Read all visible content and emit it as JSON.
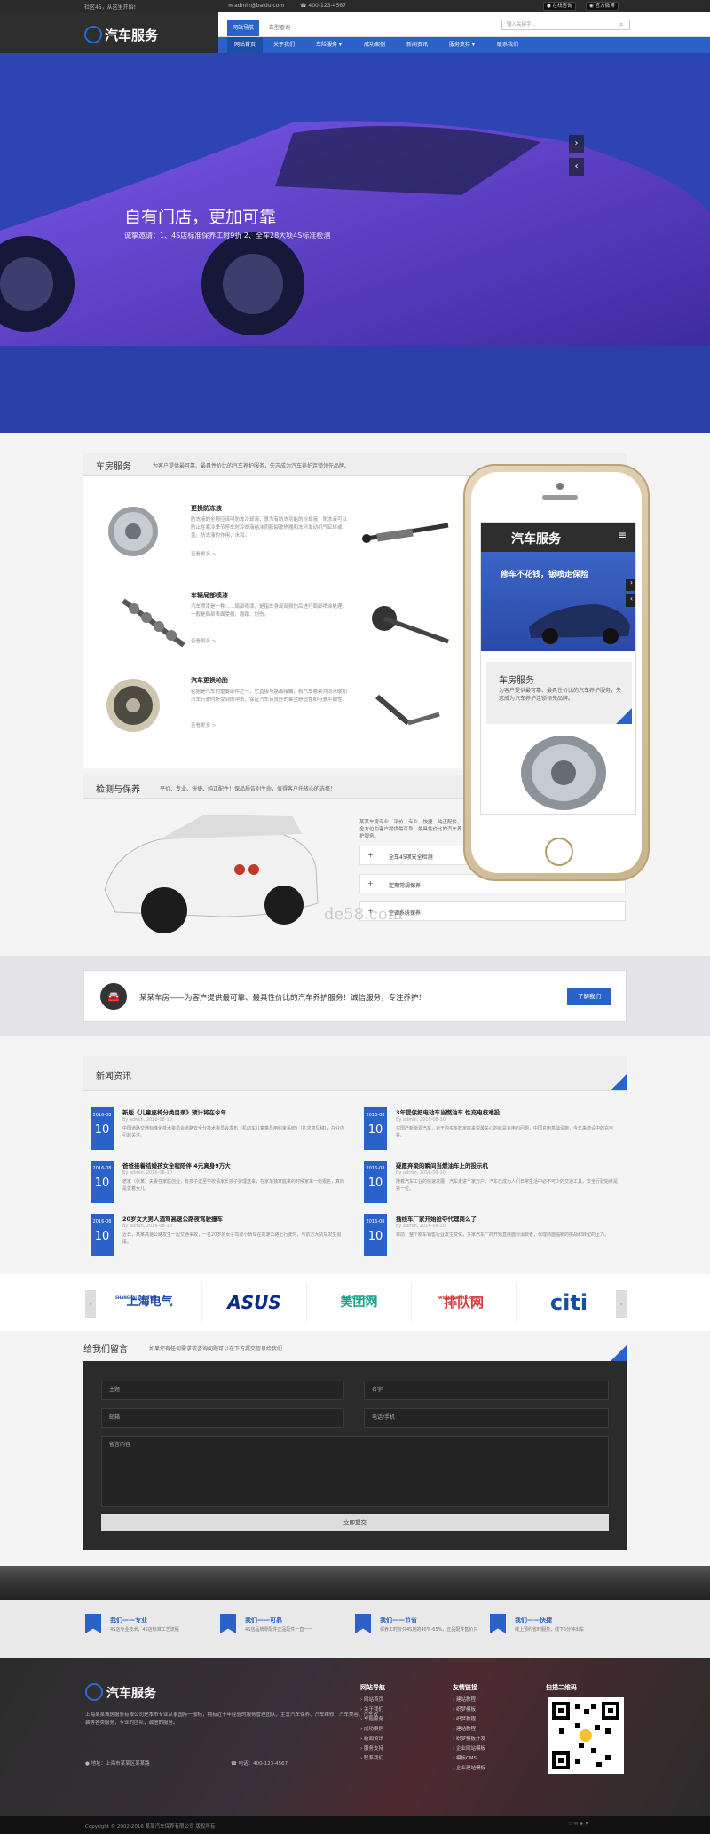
{
  "topbar": {
    "welcome": "社区45，从这里开始!",
    "email": "admin@baidu.com",
    "phone": "400-123-4567",
    "btn_online": "在线咨询",
    "btn_weibo": "官方微博"
  },
  "header": {
    "logo_text": "汽车服务",
    "tabs": [
      "网站导航",
      "车型查询"
    ],
    "search_placeholder": "输入关键字..."
  },
  "nav": [
    "网站首页",
    "关于我们",
    "车险服务",
    "成功案例",
    "新闻资讯",
    "服务支持",
    "联系我们"
  ],
  "hero": {
    "title": "自有门店，更加可靠",
    "subtitle": "诚挚邀请：1、4S店标准保养工时9折 2、全车28大项4S标准检测",
    "prev": "›",
    "next": "‹"
  },
  "services": {
    "title": "车房服务",
    "desc": "为客户提供最可靠、最具性价比的汽车养护服务，失志成为汽车养护连锁领先品牌。",
    "items": [
      {
        "title": "更换防冻液",
        "desc": "防冻液的全称应该叫防冻冷却液，意为有防冻功能的冷却液，防冻液可以防止在寒冷季节停车时冷却液结冰而胀裂散热器和冻坏发动机气缸体或盖。防冻液的作用，水和。",
        "more": "查看更多 >"
      },
      {
        "title": "车辆局部喷漆",
        "desc": "汽车喷漆是一种……局部喷漆，是指车身局部损伤后进行局部喷涂处理，一般是局部表面受损、剐蹭、划伤。",
        "more": "查看更多 >"
      },
      {
        "title": "汽车更换轮胎",
        "desc": "轮胎是汽车的重要部件之一，它直接与路面接触，和汽车悬架共同来缓和汽车行驶时所受到的冲击，保证汽车有良好的乘坐舒适性和行驶平顺性。",
        "more": "查看更多 >"
      }
    ]
  },
  "inspect": {
    "title": "检测与保养",
    "desc": "平价、专业、快捷、纯正配件！保品质告别生命，值得客户托放心的选择！",
    "intro": "某某车房专业：平价、专业、快捷、纯正配件，全方位为客户提供最可靠、最具性价比的汽车养护服务。",
    "items": [
      "全车45项安全检测",
      "定期常规保养",
      "空调系统保养"
    ]
  },
  "callout": {
    "text": "某某车房——为客户提供最可靠、最具性价比的汽车养护服务！诚信服务，专注养护!",
    "button": "了解我们"
  },
  "news": {
    "title": "新闻资讯",
    "items": [
      {
        "year": "2016-08",
        "day": "10",
        "title": "新版《儿童座椅分类目录》预计将在今年",
        "meta": "By admin, 2016-08-10",
        "desc": "中国道路交通标准化技术委员会道路安全分技术委员会发布《机动车儿童乘员用约束系统》（征求意见稿），在业内引起关注。"
      },
      {
        "year": "2016-08",
        "day": "10",
        "title": "3年提保把电动车当燃油车 性充电桩难投",
        "meta": "By admin, 2016-08-10",
        "desc": "买国产新能源汽车，对于购买多数家庭来说最关心的就是充电的问题，中国充电基础设施，今年来建设中的充电桩。"
      },
      {
        "year": "2016-08",
        "day": "10",
        "title": "爸爸接着结婚孩女全程陪伴 4元真身9万大",
        "meta": "By admin, 2016-08-10",
        "desc": "老家（张某）夫妻在家庭创业，有孩子送至学校请家长孩子护理送来，在家单独家庭来的时候家来一份报名，真的是爱着女儿。"
      },
      {
        "year": "2016-08",
        "day": "10",
        "title": "疑愿弃梁的瞬间当燃油车上的投示机",
        "meta": "By admin, 2016-08-10",
        "desc": "随着汽车工业的快速发展，汽车走进千家万户，汽车已成为人们日常生活中必不可少的交通工具，安全行驶始终是第一位。"
      },
      {
        "year": "2016-08",
        "day": "10",
        "title": "20岁女大男人酒驾高速公路夜驾驶撞车",
        "meta": "By admin, 2016-08-10",
        "desc": "近日，某某高速公路发生一起交通事故，一名20岁的女子驾驶小轿车在高速公路上行驶时，与前方大货车发生追尾。"
      },
      {
        "year": "2016-08",
        "day": "10",
        "title": "插线车厂家开始抢夺代理商么了",
        "meta": "By admin, 2016-08-10",
        "desc": "目前，整个新车销售行业发生变化，多家汽车厂商开始直接面对消费者，代理商面临新的挑战和转型的压力。"
      }
    ]
  },
  "partners": [
    "上海电气",
    "ASUS",
    "美团网",
    "排队网",
    "citi"
  ],
  "partner_subs": [
    "SHANGHAI ELECTRIC",
    "",
    "meituan.com",
    "www.paidui.com",
    ""
  ],
  "message": {
    "title": "给我们留言",
    "desc": "如果您有任何需求或咨询问题可以在下方提交信息给我们",
    "fields": {
      "subject": "主题",
      "name": "名字",
      "email": "邮箱",
      "phone": "电话/手机",
      "content": "留言内容"
    },
    "submit": "立即提交"
  },
  "promises": [
    {
      "title": "我们——专业",
      "desc": "4S店专业技术，4S店标准工艺流程"
    },
    {
      "title": "我们——可靠",
      "desc": "4S店品牌零配件正品配件一直一一"
    },
    {
      "title": "我们——节省",
      "desc": "保养工时价只4S店的40%-65%，正品配件售价只"
    },
    {
      "title": "我们——快捷",
      "desc": "线上预约省时服务，线下5分钟出车"
    }
  ],
  "footer": {
    "logo_text": "汽车服务",
    "about": "上海某某城房服务有限公司是本市专业从事国际一般标，拥有近十年经验的服务管理团队，主营汽车保养、汽车维修、汽车美容、汽车改装等各类服务，专业的团队，诚信的服务。",
    "addr": "地址：上海市某某区某某路",
    "tel": "电话：400-123-4567",
    "col1_title": "网站导航",
    "col1": [
      "网站首页",
      "关于我们",
      "车险服务",
      "成功案例",
      "新闻资讯",
      "服务支持",
      "联系我们"
    ],
    "col2_title": "友情链接",
    "col2": [
      "建站教程",
      "织梦模板",
      "织梦教程",
      "建站教程",
      "织梦模板开发",
      "企业网站模板",
      "模板CMS",
      "企业建站模板"
    ],
    "col3_title": "扫描二维码"
  },
  "copyright": "Copyright © 2002-2016 某某汽车保养有限公司 版权所有",
  "watermark": "de58.com",
  "phone_screen": {
    "logo": "汽车服务",
    "banner": "修车不花钱，钣喷走保险",
    "sec_title": "车房服务",
    "sec_desc": "为客户提供最可靠、最具性价比的汽车养护服务，失志成为汽车养护连锁领先品牌。"
  },
  "colors": {
    "brand": "#2a62c9",
    "dark": "#2b2b2b"
  }
}
